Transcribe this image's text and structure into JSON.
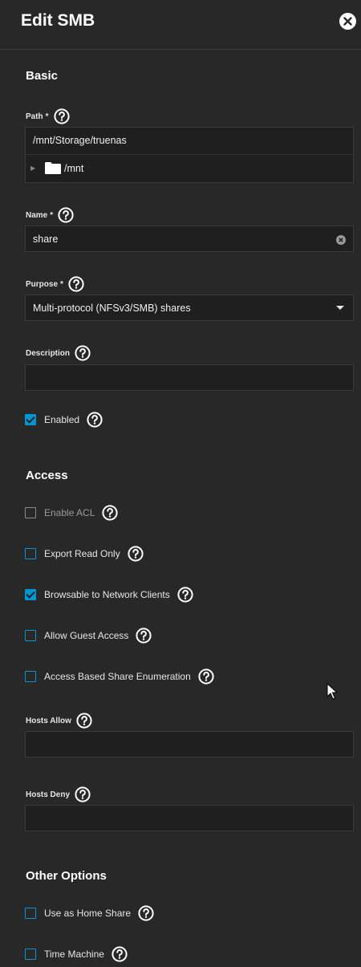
{
  "header": {
    "title": "Edit SMB",
    "close_icon": "close-icon"
  },
  "sections": {
    "basic": "Basic",
    "access": "Access",
    "other": "Other Options"
  },
  "path": {
    "label": "Path",
    "required": "*",
    "value": "/mnt/Storage/truenas",
    "tree_item": "/mnt"
  },
  "name": {
    "label": "Name",
    "required": "*",
    "value": "share"
  },
  "purpose": {
    "label": "Purpose",
    "required": "*",
    "value": "Multi-protocol (NFSv3/SMB) shares"
  },
  "description": {
    "label": "Description",
    "value": ""
  },
  "enabled": {
    "label": "Enabled",
    "checked": true
  },
  "access": {
    "enable_acl": {
      "label": "Enable ACL",
      "checked": false,
      "disabled": true
    },
    "export_read_only": {
      "label": "Export Read Only",
      "checked": false
    },
    "browsable": {
      "label": "Browsable to Network Clients",
      "checked": true
    },
    "guest_access": {
      "label": "Allow Guest Access",
      "checked": false
    },
    "abe": {
      "label": "Access Based Share Enumeration",
      "checked": false
    }
  },
  "hosts_allow": {
    "label": "Hosts Allow",
    "value": ""
  },
  "hosts_deny": {
    "label": "Hosts Deny",
    "value": ""
  },
  "other": {
    "home_share": {
      "label": "Use as Home Share",
      "checked": false
    },
    "time_machine": {
      "label": "Time Machine",
      "checked": false
    }
  },
  "colors": {
    "background": "#282828",
    "field": "#1f1f1f",
    "accent": "#0095d5"
  }
}
